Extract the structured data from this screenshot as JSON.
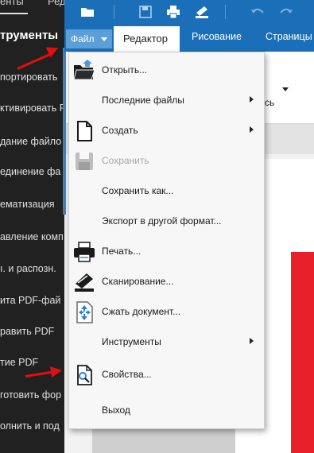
{
  "left_panel": {
    "tabs": [
      "енты",
      "Ред"
    ],
    "title": "трументы",
    "items": [
      "портировать",
      "ктивировать P",
      "дание файло",
      "единение фа",
      "ематизация",
      "авление комп",
      "ı. и распозн.",
      "ита PDF-фай",
      "равить PDF",
      "тие PDF",
      "готовить фор",
      "олнить и под"
    ]
  },
  "file_menu_button": {
    "label": "Файл"
  },
  "ribbon_tabs": [
    "Редактор",
    "Рисование",
    "Страницы"
  ],
  "ribbon_partial_text": "сь",
  "menu": {
    "items": [
      {
        "label": "Открыть...",
        "icon": "open-folder-icon",
        "enabled": true,
        "submenu": false
      },
      {
        "label": "Последние файлы",
        "icon": "",
        "enabled": true,
        "submenu": true
      },
      {
        "label": "Создать",
        "icon": "new-document-icon",
        "enabled": true,
        "submenu": true
      },
      {
        "label": "Сохранить",
        "icon": "save-icon",
        "enabled": false,
        "submenu": false
      },
      {
        "label": "Сохранить как...",
        "icon": "",
        "enabled": true,
        "submenu": false
      },
      {
        "label": "Экспорт в другой формат...",
        "icon": "",
        "enabled": true,
        "submenu": false
      },
      {
        "label": "Печать...",
        "icon": "print-icon",
        "enabled": true,
        "submenu": false
      },
      {
        "label": "Сканирование...",
        "icon": "scan-icon",
        "enabled": true,
        "submenu": false
      },
      {
        "label": "Сжать документ...",
        "icon": "compress-icon",
        "enabled": true,
        "submenu": false
      },
      {
        "label": "Инструменты",
        "icon": "",
        "enabled": true,
        "submenu": true
      },
      {
        "label": "Свойства...",
        "icon": "properties-icon",
        "enabled": true,
        "submenu": false
      },
      {
        "label": "Выход",
        "icon": "",
        "enabled": true,
        "submenu": false
      }
    ]
  },
  "colors": {
    "toolbar_blue": "#1b6fb8",
    "arrow_red": "#e01010",
    "accent_red": "#e8202a"
  }
}
